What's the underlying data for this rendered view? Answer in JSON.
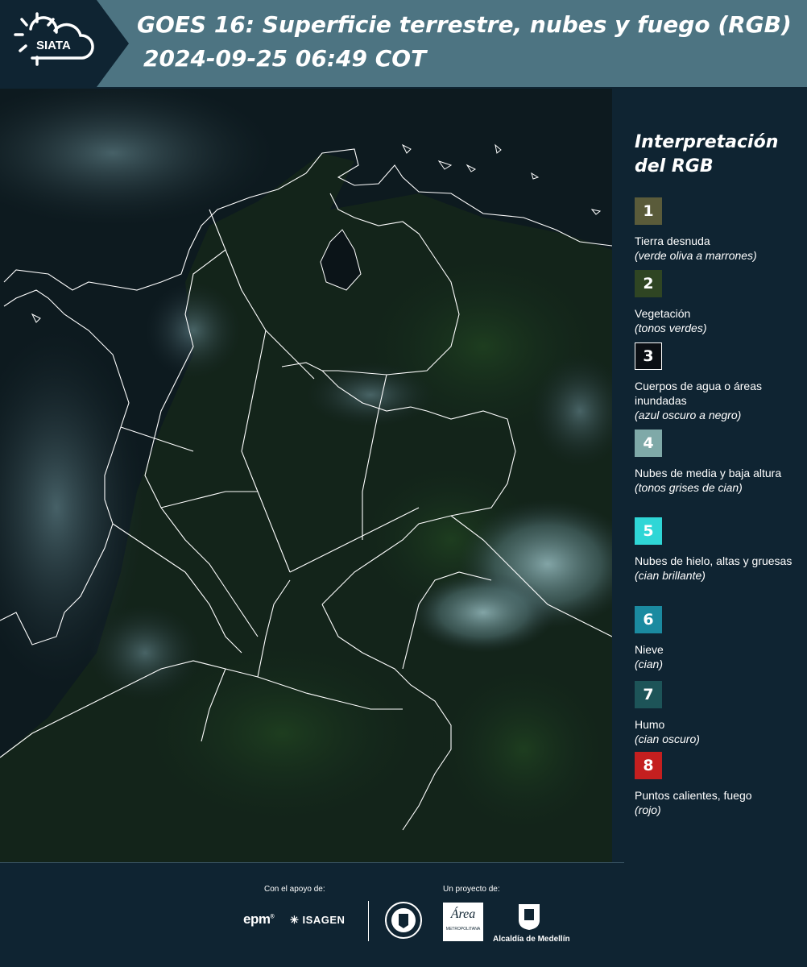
{
  "header": {
    "logo_text": "SIATA",
    "title_line1": "GOES 16: Superficie terrestre, nubes y fuego (RGB)",
    "title_line2": "2024-09-25 06:49 COT"
  },
  "legend": {
    "title": "Interpretación del RGB",
    "items": [
      {
        "num": "1",
        "label": "Tierra desnuda",
        "desc": "(verde oliva a marrones)",
        "color": "#5a5b3a",
        "border": "#5a5b3a"
      },
      {
        "num": "2",
        "label": "Vegetación",
        "desc": "(tonos verdes)",
        "color": "#2f4523",
        "border": "#2f4523"
      },
      {
        "num": "3",
        "label": "Cuerpos de agua o áreas inundadas",
        "desc": "(azul oscuro a negro)",
        "color": "#0b0f14",
        "border": "#ffffff"
      },
      {
        "num": "4",
        "label": "Nubes de media y baja altura",
        "desc": "(tonos grises de cian)",
        "color": "#7fa9a8",
        "border": "#7fa9a8"
      },
      {
        "num": "5",
        "label": "Nubes de hielo, altas y gruesas",
        "desc": "(cian brillante)",
        "color": "#2fd6d6",
        "border": "#2fd6d6"
      },
      {
        "num": "6",
        "label": "Nieve",
        "desc": "(cian)",
        "color": "#1b8aa0",
        "border": "#1b8aa0"
      },
      {
        "num": "7",
        "label": "Humo",
        "desc": "(cian oscuro)",
        "color": "#1d5458",
        "border": "#1d5458"
      },
      {
        "num": "8",
        "label": "Puntos calientes, fuego",
        "desc": "(rojo)",
        "color": "#c41f1f",
        "border": "#c41f1f"
      }
    ]
  },
  "footer": {
    "support_caption": "Con el apoyo de:",
    "project_caption": "Un proyecto de:",
    "epm": "epm",
    "isagen": "ISAGEN",
    "area_top": "Área",
    "area_sub": "METROPOLITANA",
    "alcaldia": "Alcaldía de Medellín"
  },
  "colors": {
    "header_bg": "#0f2432",
    "title_band": "#4d7482",
    "panel_bg": "#0f2432",
    "land_dark": "#122216",
    "water": "#0a1418",
    "borders": "#ffffff"
  }
}
